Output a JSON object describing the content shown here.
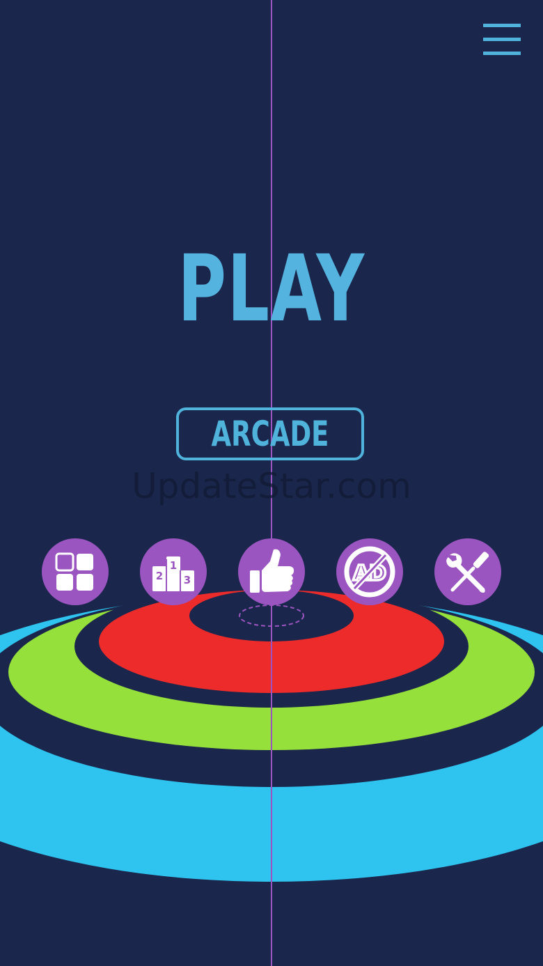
{
  "title": {
    "play_label": "PLAY"
  },
  "mode": {
    "arcade_label": "ARCADE"
  },
  "watermark": {
    "text": "UpdateStar.com"
  },
  "toolbar": {
    "menu_icon": "hamburger-menu-icon",
    "buttons": [
      {
        "icon": "level-grid-icon"
      },
      {
        "icon": "podium-icon",
        "podium_labels": [
          "2",
          "1",
          "3"
        ]
      },
      {
        "icon": "thumbs-up-icon"
      },
      {
        "icon": "no-ads-icon",
        "ad_label": "AD"
      },
      {
        "icon": "wrench-screwdriver-icon"
      }
    ]
  },
  "colors": {
    "background": "#1a264b",
    "accent": "#4fb3dc",
    "button_purple": "#9b55c0",
    "center_line": "#9b55c0",
    "ring_red": "#ed2b2b",
    "ring_green": "#95e03b",
    "ring_blue": "#2ec4ef",
    "watermark": "#111a33"
  }
}
